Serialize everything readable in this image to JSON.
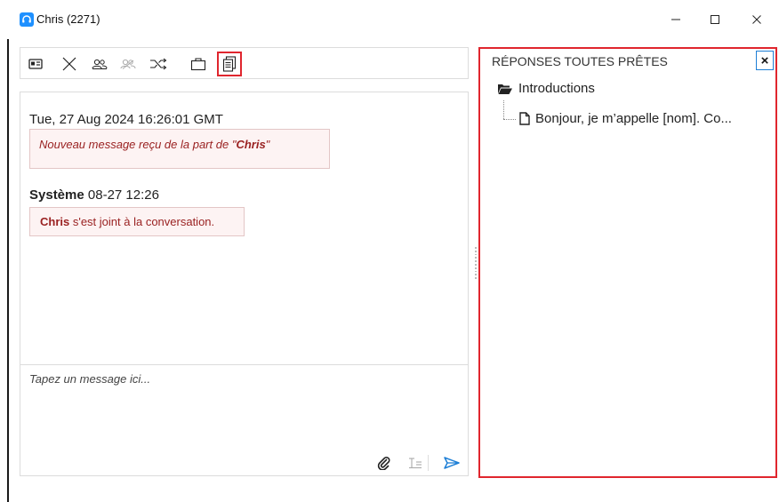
{
  "window": {
    "title": "Chris (2271)",
    "controls": [
      "minimize",
      "maximize",
      "close"
    ]
  },
  "toolbar": {
    "buttons": [
      {
        "icon": "contact-card-icon",
        "state": "enabled"
      },
      {
        "icon": "end-chat-icon",
        "state": "enabled"
      },
      {
        "icon": "transfer-agent-icon",
        "state": "enabled"
      },
      {
        "icon": "conference-icon",
        "state": "disabled"
      },
      {
        "icon": "transfer-queue-icon",
        "state": "enabled"
      },
      {
        "icon": "briefcase-icon",
        "state": "enabled"
      },
      {
        "icon": "canned-responses-icon",
        "state": "highlighted"
      }
    ]
  },
  "chat": {
    "timestamp": "Tue, 27 Aug 2024 16:26:01 GMT",
    "notice_prefix": "Nouveau message reçu de la part de ",
    "notice_quote_open": "\"",
    "notice_name": "Chris",
    "notice_quote_close": "\"",
    "system_sender": "Système",
    "system_time": "08-27 12:26",
    "system_name": "Chris",
    "system_text": " s'est joint à la conversation."
  },
  "compose": {
    "placeholder": "Tapez un message ici..."
  },
  "canned_panel": {
    "title": "RÉPONSES TOUTES PRÊTES",
    "close_label": "×",
    "folder": "Introductions",
    "item": "Bonjour, je m’appelle [nom]. Co..."
  },
  "colors": {
    "accent": "#1e90ff",
    "highlight_border": "#e0262e",
    "message_text": "#9a2222",
    "message_bg": "#fdf3f3"
  }
}
